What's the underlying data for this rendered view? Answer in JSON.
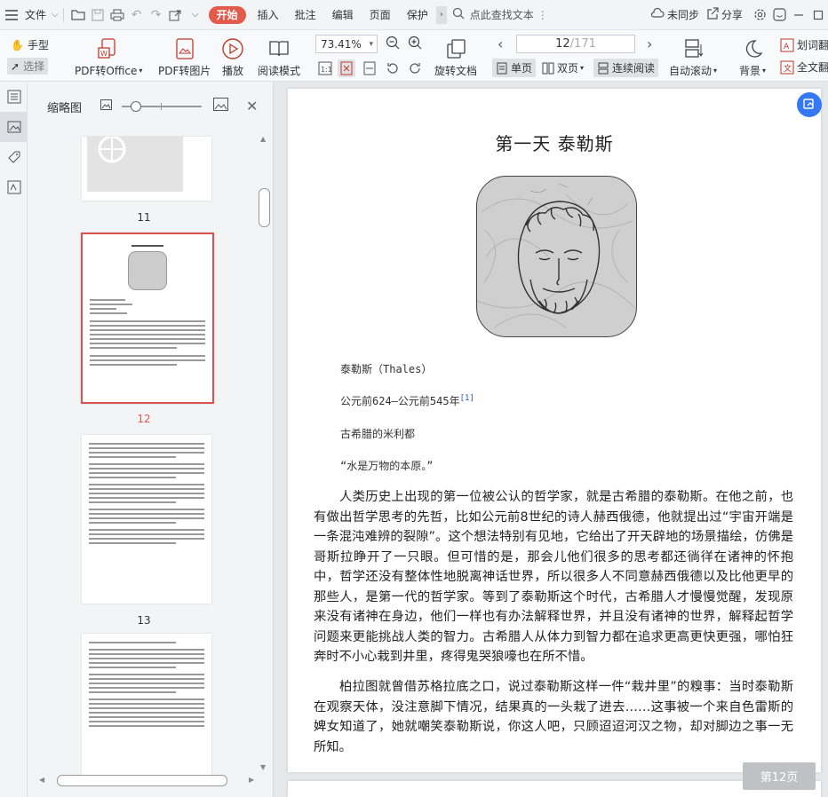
{
  "menubar": {
    "file_label": "文件",
    "tabs": [
      "开始",
      "插入",
      "批注",
      "编辑",
      "页面",
      "保护"
    ],
    "search_label": "点此查找文本",
    "sync_label": "未同步",
    "share_label": "分享"
  },
  "ribbon": {
    "hand_label": "手型",
    "select_label": "选择",
    "pdf_office_label": "PDF转Office",
    "pdf_image_label": "PDF转图片",
    "play_label": "播放",
    "read_mode_label": "阅读模式",
    "zoom_value": "73.41%",
    "rotate_label": "旋转文档",
    "page_current": "12",
    "page_total": "/171",
    "single_label": "单页",
    "double_label": "双页",
    "continuous_label": "连续阅读",
    "autoscroll_label": "自动滚动",
    "background_label": "背景",
    "translate_label": "划词翻",
    "fulltext_label": "全文翻"
  },
  "thumbpanel": {
    "title": "缩略图",
    "thumbs": [
      {
        "number": "11"
      },
      {
        "number": "12"
      },
      {
        "number": "13"
      }
    ]
  },
  "document": {
    "title": "第一天  泰勒斯",
    "name_line": "泰勒斯（Thales）",
    "years_line": "公元前624—公元前545年",
    "years_footnote": "[1]",
    "place_line": "古希腊的米利都",
    "quote_line": "“水是万物的本原。”",
    "paragraph1": "人类历史上出现的第一位被公认的哲学家，就是古希腊的泰勒斯。在他之前，也有做出哲学思考的先哲，比如公元前8世纪的诗人赫西俄德，他就提出过“宇宙开端是一条混沌难辨的裂隙”。这个想法特别有见地，它给出了开天辟地的场景描绘，仿佛是哥斯拉睁开了一只眼。但可惜的是，那会儿他们很多的思考都还徜徉在诸神的怀抱中，哲学还没有整体性地脱离神话世界，所以很多人不同意赫西俄德以及比他更早的那些人，是第一代的哲学家。等到了泰勒斯这个时代，古希腊人才慢慢觉醒，发现原来没有诸神在身边，他们一样也有办法解释世界，并且没有诸神的世界，解释起哲学问题来更能挑战人类的智力。古希腊人从体力到智力都在追求更高更快更强，哪怕狂奔时不小心栽到井里，疼得鬼哭狼嚎也在所不惜。",
    "paragraph2": "柏拉图就曾借苏格拉底之口，说过泰勒斯这样一件“栽井里”的糗事：当时泰勒斯在观察天体，没注意脚下情况，结果真的一头栽了进去……这事被一个来自色雷斯的婢女知道了，她就嘲笑泰勒斯说，你这人吧，只顾迢迢河汉之物，却对脚边之事一无所知。"
  },
  "page_badge": "第12页"
}
